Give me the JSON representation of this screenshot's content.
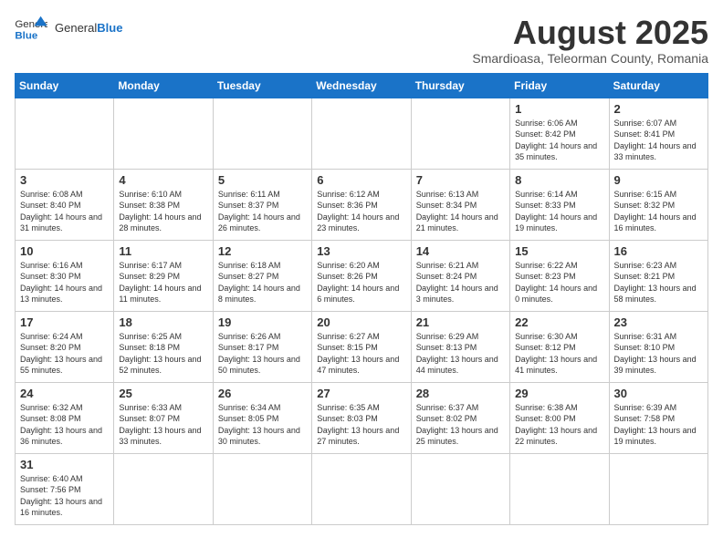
{
  "header": {
    "logo_general": "General",
    "logo_blue": "Blue",
    "month_year": "August 2025",
    "subtitle": "Smardioasa, Teleorman County, Romania"
  },
  "weekdays": [
    "Sunday",
    "Monday",
    "Tuesday",
    "Wednesday",
    "Thursday",
    "Friday",
    "Saturday"
  ],
  "weeks": [
    [
      {
        "day": "",
        "info": ""
      },
      {
        "day": "",
        "info": ""
      },
      {
        "day": "",
        "info": ""
      },
      {
        "day": "",
        "info": ""
      },
      {
        "day": "",
        "info": ""
      },
      {
        "day": "1",
        "info": "Sunrise: 6:06 AM\nSunset: 8:42 PM\nDaylight: 14 hours and 35 minutes."
      },
      {
        "day": "2",
        "info": "Sunrise: 6:07 AM\nSunset: 8:41 PM\nDaylight: 14 hours and 33 minutes."
      }
    ],
    [
      {
        "day": "3",
        "info": "Sunrise: 6:08 AM\nSunset: 8:40 PM\nDaylight: 14 hours and 31 minutes."
      },
      {
        "day": "4",
        "info": "Sunrise: 6:10 AM\nSunset: 8:38 PM\nDaylight: 14 hours and 28 minutes."
      },
      {
        "day": "5",
        "info": "Sunrise: 6:11 AM\nSunset: 8:37 PM\nDaylight: 14 hours and 26 minutes."
      },
      {
        "day": "6",
        "info": "Sunrise: 6:12 AM\nSunset: 8:36 PM\nDaylight: 14 hours and 23 minutes."
      },
      {
        "day": "7",
        "info": "Sunrise: 6:13 AM\nSunset: 8:34 PM\nDaylight: 14 hours and 21 minutes."
      },
      {
        "day": "8",
        "info": "Sunrise: 6:14 AM\nSunset: 8:33 PM\nDaylight: 14 hours and 19 minutes."
      },
      {
        "day": "9",
        "info": "Sunrise: 6:15 AM\nSunset: 8:32 PM\nDaylight: 14 hours and 16 minutes."
      }
    ],
    [
      {
        "day": "10",
        "info": "Sunrise: 6:16 AM\nSunset: 8:30 PM\nDaylight: 14 hours and 13 minutes."
      },
      {
        "day": "11",
        "info": "Sunrise: 6:17 AM\nSunset: 8:29 PM\nDaylight: 14 hours and 11 minutes."
      },
      {
        "day": "12",
        "info": "Sunrise: 6:18 AM\nSunset: 8:27 PM\nDaylight: 14 hours and 8 minutes."
      },
      {
        "day": "13",
        "info": "Sunrise: 6:20 AM\nSunset: 8:26 PM\nDaylight: 14 hours and 6 minutes."
      },
      {
        "day": "14",
        "info": "Sunrise: 6:21 AM\nSunset: 8:24 PM\nDaylight: 14 hours and 3 minutes."
      },
      {
        "day": "15",
        "info": "Sunrise: 6:22 AM\nSunset: 8:23 PM\nDaylight: 14 hours and 0 minutes."
      },
      {
        "day": "16",
        "info": "Sunrise: 6:23 AM\nSunset: 8:21 PM\nDaylight: 13 hours and 58 minutes."
      }
    ],
    [
      {
        "day": "17",
        "info": "Sunrise: 6:24 AM\nSunset: 8:20 PM\nDaylight: 13 hours and 55 minutes."
      },
      {
        "day": "18",
        "info": "Sunrise: 6:25 AM\nSunset: 8:18 PM\nDaylight: 13 hours and 52 minutes."
      },
      {
        "day": "19",
        "info": "Sunrise: 6:26 AM\nSunset: 8:17 PM\nDaylight: 13 hours and 50 minutes."
      },
      {
        "day": "20",
        "info": "Sunrise: 6:27 AM\nSunset: 8:15 PM\nDaylight: 13 hours and 47 minutes."
      },
      {
        "day": "21",
        "info": "Sunrise: 6:29 AM\nSunset: 8:13 PM\nDaylight: 13 hours and 44 minutes."
      },
      {
        "day": "22",
        "info": "Sunrise: 6:30 AM\nSunset: 8:12 PM\nDaylight: 13 hours and 41 minutes."
      },
      {
        "day": "23",
        "info": "Sunrise: 6:31 AM\nSunset: 8:10 PM\nDaylight: 13 hours and 39 minutes."
      }
    ],
    [
      {
        "day": "24",
        "info": "Sunrise: 6:32 AM\nSunset: 8:08 PM\nDaylight: 13 hours and 36 minutes."
      },
      {
        "day": "25",
        "info": "Sunrise: 6:33 AM\nSunset: 8:07 PM\nDaylight: 13 hours and 33 minutes."
      },
      {
        "day": "26",
        "info": "Sunrise: 6:34 AM\nSunset: 8:05 PM\nDaylight: 13 hours and 30 minutes."
      },
      {
        "day": "27",
        "info": "Sunrise: 6:35 AM\nSunset: 8:03 PM\nDaylight: 13 hours and 27 minutes."
      },
      {
        "day": "28",
        "info": "Sunrise: 6:37 AM\nSunset: 8:02 PM\nDaylight: 13 hours and 25 minutes."
      },
      {
        "day": "29",
        "info": "Sunrise: 6:38 AM\nSunset: 8:00 PM\nDaylight: 13 hours and 22 minutes."
      },
      {
        "day": "30",
        "info": "Sunrise: 6:39 AM\nSunset: 7:58 PM\nDaylight: 13 hours and 19 minutes."
      }
    ],
    [
      {
        "day": "31",
        "info": "Sunrise: 6:40 AM\nSunset: 7:56 PM\nDaylight: 13 hours and 16 minutes."
      },
      {
        "day": "",
        "info": ""
      },
      {
        "day": "",
        "info": ""
      },
      {
        "day": "",
        "info": ""
      },
      {
        "day": "",
        "info": ""
      },
      {
        "day": "",
        "info": ""
      },
      {
        "day": "",
        "info": ""
      }
    ]
  ]
}
